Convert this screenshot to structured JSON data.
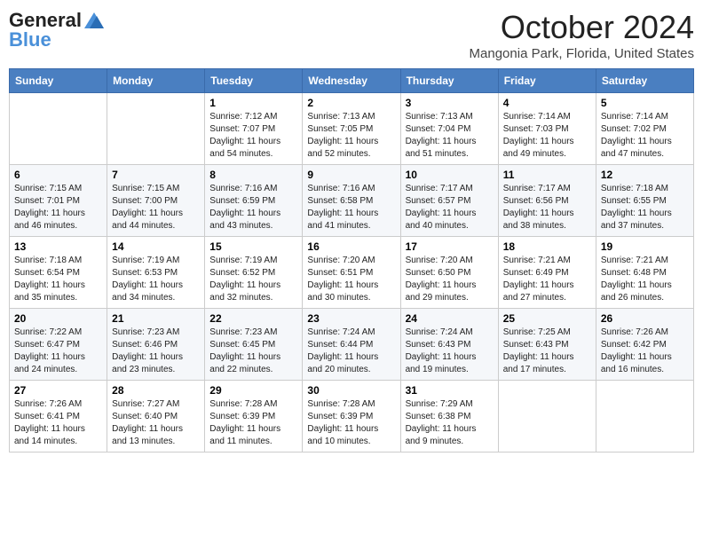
{
  "logo": {
    "general": "General",
    "blue": "Blue",
    "tagline": ""
  },
  "header": {
    "month": "October 2024",
    "location": "Mangonia Park, Florida, United States"
  },
  "columns": [
    "Sunday",
    "Monday",
    "Tuesday",
    "Wednesday",
    "Thursday",
    "Friday",
    "Saturday"
  ],
  "weeks": [
    [
      {
        "num": "",
        "sunrise": "",
        "sunset": "",
        "daylight": ""
      },
      {
        "num": "",
        "sunrise": "",
        "sunset": "",
        "daylight": ""
      },
      {
        "num": "1",
        "sunrise": "Sunrise: 7:12 AM",
        "sunset": "Sunset: 7:07 PM",
        "daylight": "Daylight: 11 hours and 54 minutes."
      },
      {
        "num": "2",
        "sunrise": "Sunrise: 7:13 AM",
        "sunset": "Sunset: 7:05 PM",
        "daylight": "Daylight: 11 hours and 52 minutes."
      },
      {
        "num": "3",
        "sunrise": "Sunrise: 7:13 AM",
        "sunset": "Sunset: 7:04 PM",
        "daylight": "Daylight: 11 hours and 51 minutes."
      },
      {
        "num": "4",
        "sunrise": "Sunrise: 7:14 AM",
        "sunset": "Sunset: 7:03 PM",
        "daylight": "Daylight: 11 hours and 49 minutes."
      },
      {
        "num": "5",
        "sunrise": "Sunrise: 7:14 AM",
        "sunset": "Sunset: 7:02 PM",
        "daylight": "Daylight: 11 hours and 47 minutes."
      }
    ],
    [
      {
        "num": "6",
        "sunrise": "Sunrise: 7:15 AM",
        "sunset": "Sunset: 7:01 PM",
        "daylight": "Daylight: 11 hours and 46 minutes."
      },
      {
        "num": "7",
        "sunrise": "Sunrise: 7:15 AM",
        "sunset": "Sunset: 7:00 PM",
        "daylight": "Daylight: 11 hours and 44 minutes."
      },
      {
        "num": "8",
        "sunrise": "Sunrise: 7:16 AM",
        "sunset": "Sunset: 6:59 PM",
        "daylight": "Daylight: 11 hours and 43 minutes."
      },
      {
        "num": "9",
        "sunrise": "Sunrise: 7:16 AM",
        "sunset": "Sunset: 6:58 PM",
        "daylight": "Daylight: 11 hours and 41 minutes."
      },
      {
        "num": "10",
        "sunrise": "Sunrise: 7:17 AM",
        "sunset": "Sunset: 6:57 PM",
        "daylight": "Daylight: 11 hours and 40 minutes."
      },
      {
        "num": "11",
        "sunrise": "Sunrise: 7:17 AM",
        "sunset": "Sunset: 6:56 PM",
        "daylight": "Daylight: 11 hours and 38 minutes."
      },
      {
        "num": "12",
        "sunrise": "Sunrise: 7:18 AM",
        "sunset": "Sunset: 6:55 PM",
        "daylight": "Daylight: 11 hours and 37 minutes."
      }
    ],
    [
      {
        "num": "13",
        "sunrise": "Sunrise: 7:18 AM",
        "sunset": "Sunset: 6:54 PM",
        "daylight": "Daylight: 11 hours and 35 minutes."
      },
      {
        "num": "14",
        "sunrise": "Sunrise: 7:19 AM",
        "sunset": "Sunset: 6:53 PM",
        "daylight": "Daylight: 11 hours and 34 minutes."
      },
      {
        "num": "15",
        "sunrise": "Sunrise: 7:19 AM",
        "sunset": "Sunset: 6:52 PM",
        "daylight": "Daylight: 11 hours and 32 minutes."
      },
      {
        "num": "16",
        "sunrise": "Sunrise: 7:20 AM",
        "sunset": "Sunset: 6:51 PM",
        "daylight": "Daylight: 11 hours and 30 minutes."
      },
      {
        "num": "17",
        "sunrise": "Sunrise: 7:20 AM",
        "sunset": "Sunset: 6:50 PM",
        "daylight": "Daylight: 11 hours and 29 minutes."
      },
      {
        "num": "18",
        "sunrise": "Sunrise: 7:21 AM",
        "sunset": "Sunset: 6:49 PM",
        "daylight": "Daylight: 11 hours and 27 minutes."
      },
      {
        "num": "19",
        "sunrise": "Sunrise: 7:21 AM",
        "sunset": "Sunset: 6:48 PM",
        "daylight": "Daylight: 11 hours and 26 minutes."
      }
    ],
    [
      {
        "num": "20",
        "sunrise": "Sunrise: 7:22 AM",
        "sunset": "Sunset: 6:47 PM",
        "daylight": "Daylight: 11 hours and 24 minutes."
      },
      {
        "num": "21",
        "sunrise": "Sunrise: 7:23 AM",
        "sunset": "Sunset: 6:46 PM",
        "daylight": "Daylight: 11 hours and 23 minutes."
      },
      {
        "num": "22",
        "sunrise": "Sunrise: 7:23 AM",
        "sunset": "Sunset: 6:45 PM",
        "daylight": "Daylight: 11 hours and 22 minutes."
      },
      {
        "num": "23",
        "sunrise": "Sunrise: 7:24 AM",
        "sunset": "Sunset: 6:44 PM",
        "daylight": "Daylight: 11 hours and 20 minutes."
      },
      {
        "num": "24",
        "sunrise": "Sunrise: 7:24 AM",
        "sunset": "Sunset: 6:43 PM",
        "daylight": "Daylight: 11 hours and 19 minutes."
      },
      {
        "num": "25",
        "sunrise": "Sunrise: 7:25 AM",
        "sunset": "Sunset: 6:43 PM",
        "daylight": "Daylight: 11 hours and 17 minutes."
      },
      {
        "num": "26",
        "sunrise": "Sunrise: 7:26 AM",
        "sunset": "Sunset: 6:42 PM",
        "daylight": "Daylight: 11 hours and 16 minutes."
      }
    ],
    [
      {
        "num": "27",
        "sunrise": "Sunrise: 7:26 AM",
        "sunset": "Sunset: 6:41 PM",
        "daylight": "Daylight: 11 hours and 14 minutes."
      },
      {
        "num": "28",
        "sunrise": "Sunrise: 7:27 AM",
        "sunset": "Sunset: 6:40 PM",
        "daylight": "Daylight: 11 hours and 13 minutes."
      },
      {
        "num": "29",
        "sunrise": "Sunrise: 7:28 AM",
        "sunset": "Sunset: 6:39 PM",
        "daylight": "Daylight: 11 hours and 11 minutes."
      },
      {
        "num": "30",
        "sunrise": "Sunrise: 7:28 AM",
        "sunset": "Sunset: 6:39 PM",
        "daylight": "Daylight: 11 hours and 10 minutes."
      },
      {
        "num": "31",
        "sunrise": "Sunrise: 7:29 AM",
        "sunset": "Sunset: 6:38 PM",
        "daylight": "Daylight: 11 hours and 9 minutes."
      },
      {
        "num": "",
        "sunrise": "",
        "sunset": "",
        "daylight": ""
      },
      {
        "num": "",
        "sunrise": "",
        "sunset": "",
        "daylight": ""
      }
    ]
  ]
}
